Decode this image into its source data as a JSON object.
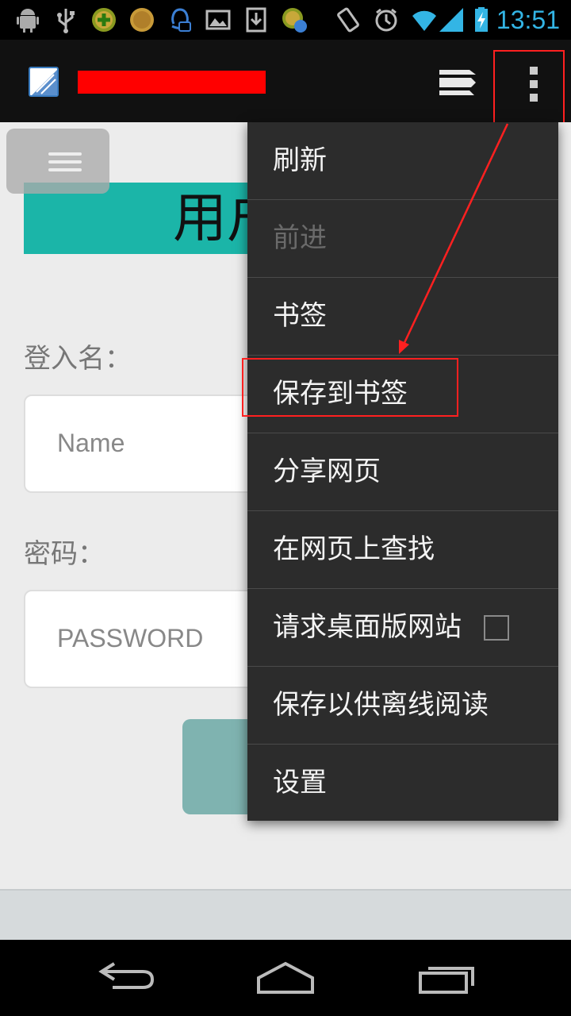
{
  "status_bar": {
    "time": "13:51",
    "icons": [
      "android-debug-icon",
      "usb-icon",
      "app-plus-icon",
      "coin-icon",
      "qq-icon",
      "image-icon",
      "download-icon",
      "app-sync-icon",
      "rotate-icon",
      "alarm-icon",
      "wifi-icon",
      "signal-icon",
      "battery-charging-icon"
    ],
    "accent_color": "#33b5e5"
  },
  "action_bar": {
    "logo_icon": "browser-logo-icon",
    "tabs_icon": "tabs-icon",
    "overflow_icon": "overflow-menu-icon",
    "redaction_color": "#ff0000"
  },
  "webpage": {
    "title": "用户登录",
    "username_label": "登入名：",
    "username_placeholder": "Name",
    "password_label": "密码：",
    "password_placeholder": "PASSWORD",
    "banner_color": "#1bb5a8"
  },
  "menu": {
    "items": [
      {
        "label": "刷新",
        "enabled": true
      },
      {
        "label": "前进",
        "enabled": false
      },
      {
        "label": "书签",
        "enabled": true
      },
      {
        "label": "保存到书签",
        "enabled": true
      },
      {
        "label": "分享网页",
        "enabled": true
      },
      {
        "label": "在网页上查找",
        "enabled": true
      },
      {
        "label": "请求桌面版网站",
        "enabled": true,
        "checkbox": false
      },
      {
        "label": "保存以供离线阅读",
        "enabled": true
      },
      {
        "label": "设置",
        "enabled": true
      }
    ]
  },
  "annotation": {
    "color": "#ff2020"
  }
}
